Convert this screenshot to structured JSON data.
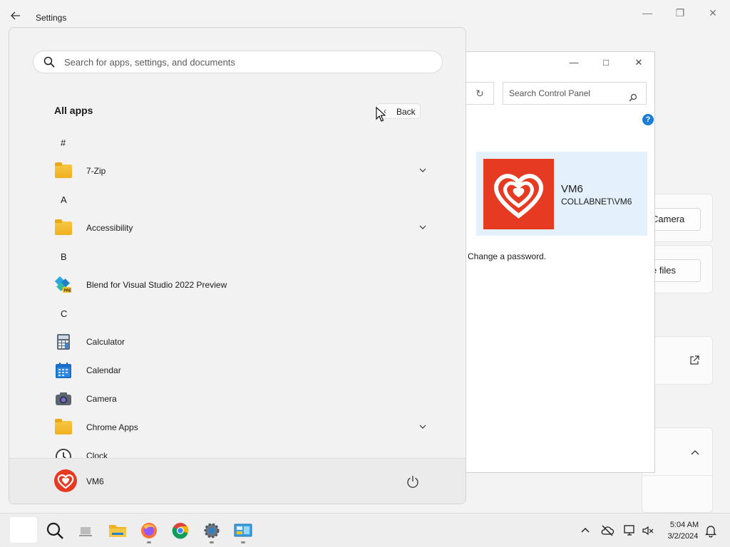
{
  "settings": {
    "title": "Settings",
    "camera_button": "Camera",
    "files_button": "e files"
  },
  "control_panel": {
    "search_placeholder": "Search Control Panel",
    "help": "?",
    "user_name": "VM6",
    "user_domain": "COLLABNET\\VM6",
    "link": "Change a password."
  },
  "start_menu": {
    "search_placeholder": "Search for apps, settings, and documents",
    "all_apps": "All apps",
    "back_label": "Back",
    "letters": [
      "#",
      "A",
      "B",
      "C"
    ],
    "apps": [
      {
        "label": "7-Zip",
        "icon": "folder-icon",
        "expandable": true
      },
      {
        "label": "Accessibility",
        "icon": "folder-icon",
        "expandable": true
      },
      {
        "label": "Blend for Visual Studio 2022 Preview",
        "icon": "blend-icon",
        "expandable": false
      },
      {
        "label": "Calculator",
        "icon": "calculator-icon",
        "expandable": false
      },
      {
        "label": "Calendar",
        "icon": "calendar-icon",
        "expandable": false
      },
      {
        "label": "Camera",
        "icon": "camera-icon",
        "expandable": false
      },
      {
        "label": "Chrome Apps",
        "icon": "folder-icon",
        "expandable": true
      },
      {
        "label": "Clock",
        "icon": "clock-icon",
        "expandable": false
      }
    ],
    "user_name": "VM6"
  },
  "taskbar": {
    "time": "5:04 AM",
    "date": "3/2/2024"
  },
  "colors": {
    "accent": "#1a7ed8",
    "avatar": "#e63b22",
    "folder": "#f0b020"
  }
}
